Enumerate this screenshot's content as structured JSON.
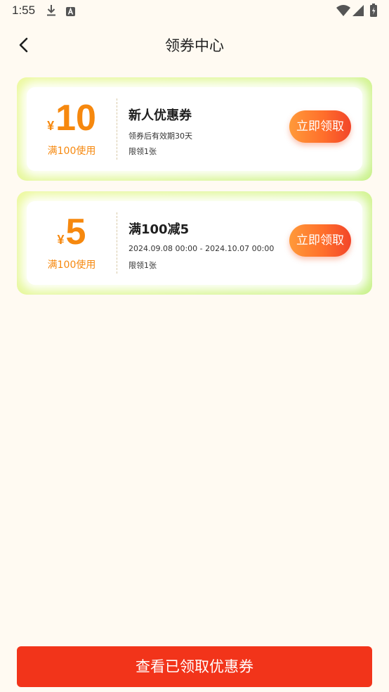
{
  "status_bar": {
    "time": "1:55",
    "icons": [
      "download-icon",
      "a-icon",
      "wifi-icon",
      "signal-icon",
      "battery-icon"
    ]
  },
  "header": {
    "title": "领券中心",
    "back_icon": "chevron-left-icon"
  },
  "coupons": [
    {
      "currency": "¥",
      "amount": "10",
      "condition": "满100使用",
      "title": "新人优惠券",
      "description": "领券后有效期30天",
      "limit": "限领1张",
      "button_label": "立即领取"
    },
    {
      "currency": "¥",
      "amount": "5",
      "condition": "满100使用",
      "title": "满100减5",
      "description": "2024.09.08 00:00 - 2024.10.07 00:00",
      "limit": "限领1张",
      "button_label": "立即领取"
    }
  ],
  "footer": {
    "button_label": "查看已领取优惠券"
  },
  "colors": {
    "background": "#FFFAF2",
    "amount_orange": "#F6880E",
    "card_green_light": "#EDF9A0",
    "card_green_dark": "#C9F28C",
    "claim_button_start": "#FF9A3A",
    "claim_button_end": "#F2452A",
    "bottom_button": "#F2341A"
  }
}
